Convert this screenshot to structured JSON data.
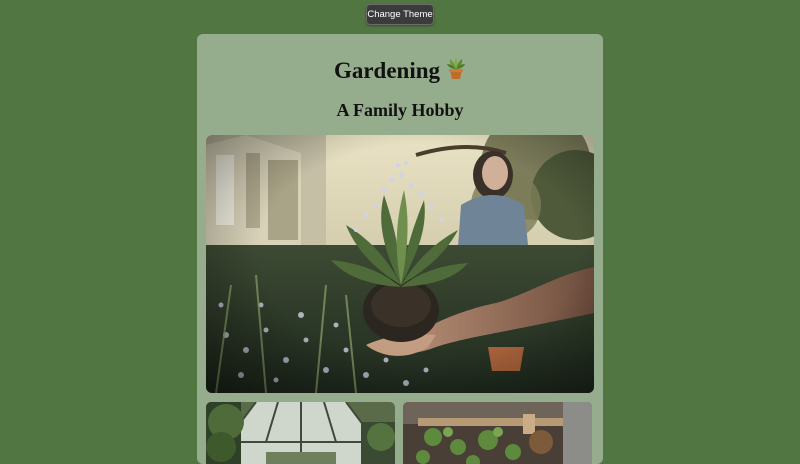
{
  "toolbar": {
    "change_theme_label": "Change Theme"
  },
  "card": {
    "title": "Gardening",
    "title_icon": "potted-plant-icon",
    "subtitle": "A Family Hobby"
  },
  "images": {
    "hero": "woman-holding-plant-photo",
    "thumb1": "greenhouse-photo",
    "thumb2": "raised-garden-bed-photo"
  },
  "colors": {
    "page_background": "#527641",
    "card_background": "#95ad8c",
    "button_background": "#3b3b3b"
  }
}
